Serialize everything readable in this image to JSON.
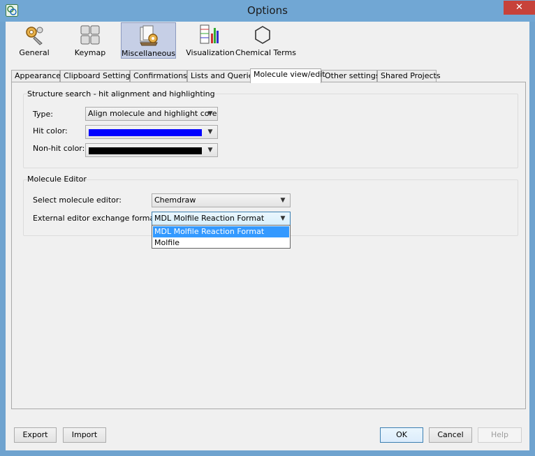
{
  "window": {
    "title": "Options"
  },
  "toolbar": {
    "items": [
      {
        "label": "General",
        "icon": "gears-icon"
      },
      {
        "label": "Keymap",
        "icon": "keyboard-icon"
      },
      {
        "label": "Miscellaneous",
        "icon": "misc-tools-icon",
        "selected": true
      },
      {
        "label": "Visualization",
        "icon": "chart-grid-icon"
      },
      {
        "label": "Chemical Terms",
        "icon": "hexagon-icon"
      }
    ]
  },
  "tabs": [
    {
      "label": "Appearance"
    },
    {
      "label": "Clipboard Settings"
    },
    {
      "label": "Confirmations"
    },
    {
      "label": "Lists and Queries"
    },
    {
      "label": "Molecule view/edit",
      "active": true
    },
    {
      "label": "Other settings"
    },
    {
      "label": "Shared Projects"
    }
  ],
  "structure_search": {
    "title": "Structure search - hit alignment and highlighting",
    "type_label": "Type:",
    "type_value": "Align molecule and highlight core",
    "hit_color_label": "Hit color:",
    "hit_color": "#0000ff",
    "nonhit_color_label": "Non-hit color:",
    "nonhit_color": "#000000"
  },
  "molecule_editor": {
    "title": "Molecule Editor",
    "select_label": "Select molecule editor:",
    "select_value": "Chemdraw",
    "format_label": "External editor exchange format:",
    "format_value": "MDL Molfile Reaction Format",
    "format_options": [
      "MDL Molfile Reaction Format",
      "Molfile"
    ]
  },
  "buttons": {
    "export": "Export",
    "import": "Import",
    "ok": "OK",
    "cancel": "Cancel",
    "help": "Help"
  },
  "colors": {
    "titlebar": "#71a7d4",
    "selection": "#3399ff"
  }
}
